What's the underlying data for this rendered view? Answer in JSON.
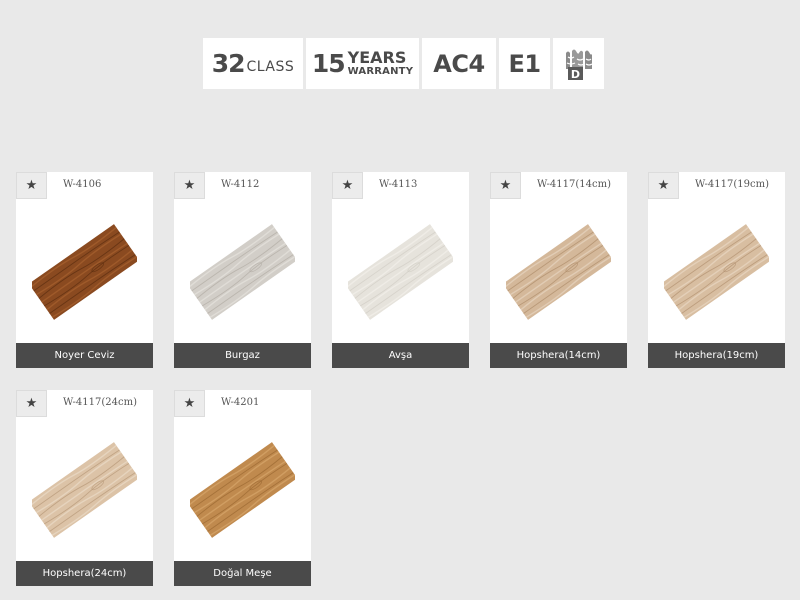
{
  "badges": {
    "class": {
      "number": "32",
      "word": "CLASS"
    },
    "warranty": {
      "number": "15",
      "top": "YEARS",
      "bottom": "WARRANTY"
    },
    "abrasion": {
      "text": "AC4"
    },
    "emission": {
      "text": "E1"
    },
    "d_badge": {
      "icon": "wood-layers-d-icon",
      "letter": "D"
    }
  },
  "favorite_icon": "star-icon",
  "products": [
    {
      "code": "W-4106",
      "name": "Noyer Ceviz",
      "colors": {
        "base": "#8a4a20",
        "grain": "#5e2f10",
        "light": "#a5602e"
      }
    },
    {
      "code": "W-4112",
      "name": "Burgaz",
      "colors": {
        "base": "#d2cec8",
        "grain": "#b3aea6",
        "light": "#e4e1dc"
      }
    },
    {
      "code": "W-4113",
      "name": "Avşa",
      "colors": {
        "base": "#e6e3dc",
        "grain": "#d2cec5",
        "light": "#f1efea"
      }
    },
    {
      "code": "W-4117(14cm)",
      "name": "Hopshera(14cm)",
      "colors": {
        "base": "#d4b89a",
        "grain": "#b08f6c",
        "light": "#e6d3bd"
      }
    },
    {
      "code": "W-4117(19cm)",
      "name": "Hopshera(19cm)",
      "colors": {
        "base": "#d8bea1",
        "grain": "#b49373",
        "light": "#e8d6c2"
      }
    },
    {
      "code": "W-4117(24cm)",
      "name": "Hopshera(24cm)",
      "colors": {
        "base": "#dcc3a7",
        "grain": "#b89a79",
        "light": "#ead9c5"
      }
    },
    {
      "code": "W-4201",
      "name": "Doğal Meşe",
      "colors": {
        "base": "#c08a4e",
        "grain": "#9c6a33",
        "light": "#d6a46a"
      }
    }
  ]
}
